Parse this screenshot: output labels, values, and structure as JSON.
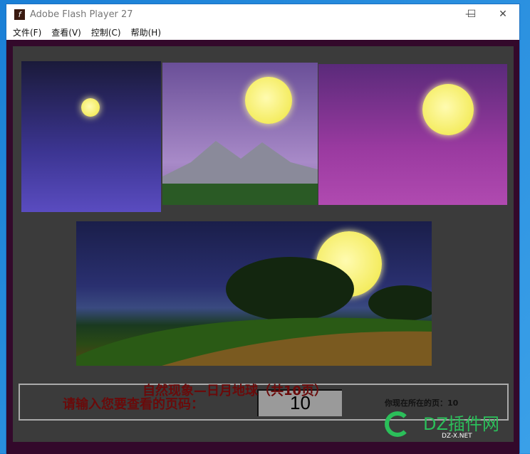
{
  "window": {
    "title": "Adobe Flash Player 27",
    "minimize": "—",
    "maximize": "☐",
    "close": "✕"
  },
  "menu": [
    "文件(F)",
    "查看(V)",
    "控制(C)",
    "帮助(H)"
  ],
  "controls": {
    "prompt": "请输入您要查看的页码：",
    "page_input_value": "10",
    "current_page_label": "你现在所在的页：10"
  },
  "subtitle": "自然现象—日月地球（共10页）",
  "watermark": {
    "text": "DZ插件网",
    "sub": "DZ-X.NET"
  }
}
